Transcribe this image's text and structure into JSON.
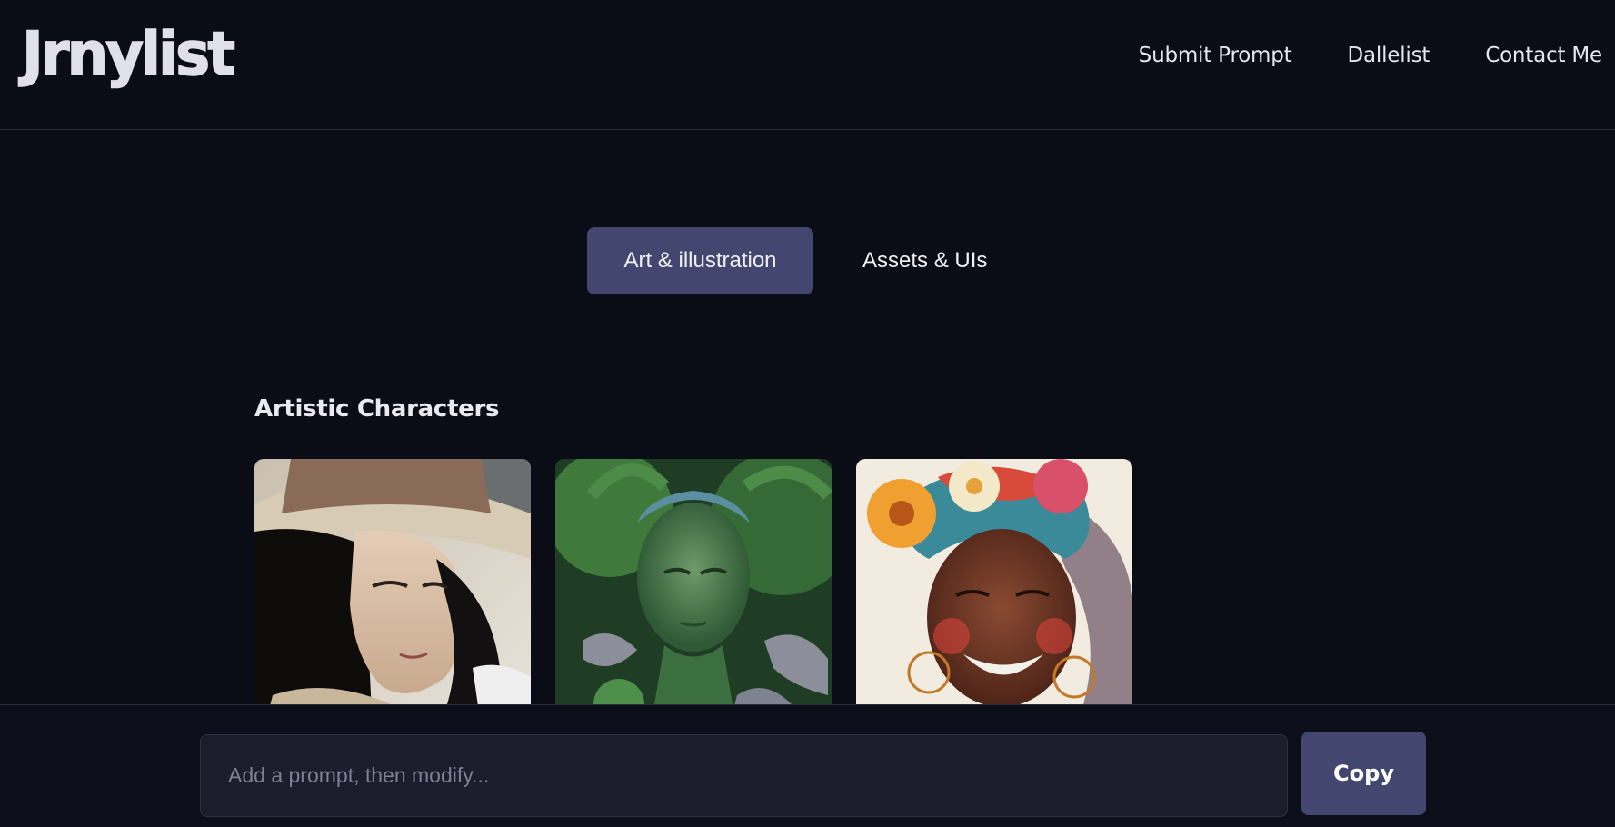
{
  "header": {
    "logo": "Jrnylist",
    "nav": [
      {
        "label": "Submit Prompt"
      },
      {
        "label": "Dallelist"
      },
      {
        "label": "Contact Me"
      }
    ]
  },
  "tabs": [
    {
      "label": "Art & illustration",
      "active": true
    },
    {
      "label": "Assets & UIs",
      "active": false
    }
  ],
  "section": {
    "title": "Artistic Characters",
    "images": [
      {
        "name": "woman-in-hat-image"
      },
      {
        "name": "green-nature-goddess-image"
      },
      {
        "name": "watercolor-woman-flowers-image"
      }
    ]
  },
  "prompt": {
    "placeholder": "Add a prompt, then modify...",
    "value": ""
  },
  "copy_button": {
    "label": "Copy"
  },
  "colors": {
    "background": "#0a0c16",
    "accent": "#434770",
    "input_bg": "#1b1d2c"
  }
}
